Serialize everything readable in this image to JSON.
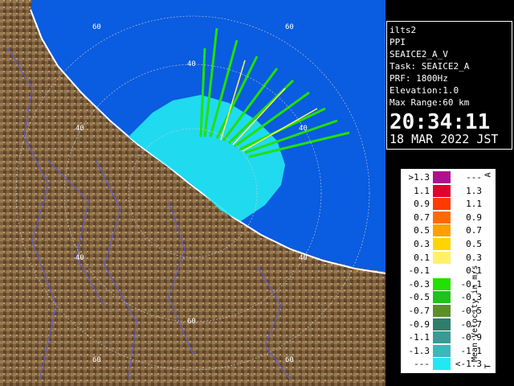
{
  "info": {
    "station": "ilts2",
    "scan_type": "PPI",
    "product": "SEAICE2_A_V",
    "task": "Task: SEAICE2_A",
    "prf": "PRF: 1800Hz",
    "elevation": "Elevation:1.0",
    "max_range": "Max Range:60 km",
    "time": "20:34:11",
    "date": "18 MAR 2022 JST"
  },
  "legend": {
    "title": "Mean Velocity in m/s",
    "corner_top": "A",
    "corner_bottom": "T",
    "rows": [
      {
        "lo": ">1.3",
        "hi": "---",
        "color": "#b0108f"
      },
      {
        "lo": "1.1",
        "hi": "1.3",
        "color": "#e0002a"
      },
      {
        "lo": "0.9",
        "hi": "1.1",
        "color": "#ff3a00"
      },
      {
        "lo": "0.7",
        "hi": "0.9",
        "color": "#ff6a00"
      },
      {
        "lo": "0.5",
        "hi": "0.7",
        "color": "#ffa000"
      },
      {
        "lo": "0.3",
        "hi": "0.5",
        "color": "#ffd400"
      },
      {
        "lo": "0.1",
        "hi": "0.3",
        "color": "#fff26a"
      },
      {
        "lo": "-0.1",
        "hi": "0.1",
        "color": "#ffffff"
      },
      {
        "lo": "-0.3",
        "hi": "-0.1",
        "color": "#22e000"
      },
      {
        "lo": "-0.5",
        "hi": "-0.3",
        "color": "#1ec41a"
      },
      {
        "lo": "-0.7",
        "hi": "-0.5",
        "color": "#5a8f2a"
      },
      {
        "lo": "-0.9",
        "hi": "-0.7",
        "color": "#2d7e6a"
      },
      {
        "lo": "-1.1",
        "hi": "-0.9",
        "color": "#3a9a96"
      },
      {
        "lo": "-1.3",
        "hi": "-1.1",
        "color": "#3ab8bc"
      },
      {
        "lo": "---",
        "hi": "<-1.3",
        "color": "#22e8f2"
      }
    ]
  },
  "radar": {
    "ring_labels": [
      "60",
      "40",
      "40",
      "40",
      "40",
      "60",
      "60"
    ],
    "colors": {
      "sea": "#0a5ce0",
      "land": "#8a6a44",
      "echo_cyan": "#22e8f2",
      "echo_green": "#22e000",
      "rivers": "#5a5ae0"
    }
  }
}
